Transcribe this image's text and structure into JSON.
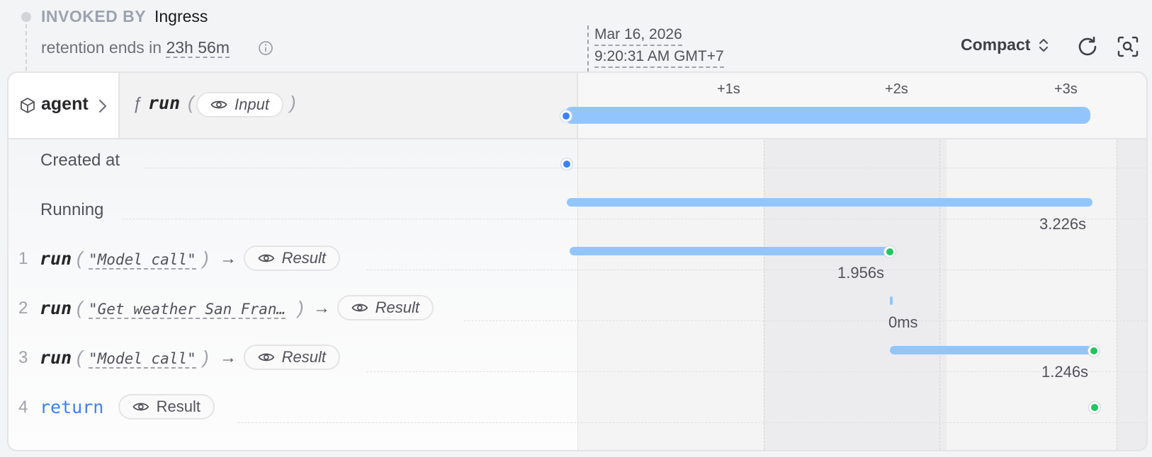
{
  "header": {
    "invoked_by_label": "INVOKED BY",
    "invoked_by_value": "Ingress",
    "retention_prefix": "retention ends in",
    "retention_value": "23h 56m",
    "date": "Mar 16, 2026",
    "time": "9:20:31 AM GMT+7",
    "view_mode": "Compact"
  },
  "target": {
    "service": "agent",
    "fn_symbol": "ƒ",
    "handler": "run",
    "input_label": "Input"
  },
  "timeline": {
    "ticks": [
      "+1s",
      "+2s",
      "+3s"
    ]
  },
  "rows": {
    "created_at": "Created at",
    "running": "Running",
    "running_duration": "3.226s"
  },
  "steps": [
    {
      "num": "1",
      "name": "run",
      "arg": "\"Model call\"",
      "result_label": "Result",
      "duration": "1.956s"
    },
    {
      "num": "2",
      "name": "run",
      "arg": "\"Get weather San Fran…",
      "result_label": "Result",
      "duration": "0ms"
    },
    {
      "num": "3",
      "name": "run",
      "arg": "\"Model call\"",
      "result_label": "Result",
      "duration": "1.246s"
    },
    {
      "num": "4",
      "name": "return",
      "result_label": "Result"
    }
  ],
  "icons": {
    "info": "info-icon",
    "sort": "chevron-up-down-icon",
    "refresh": "refresh-icon",
    "zoom": "zoom-fit-icon",
    "box": "cube-icon",
    "chevron": "chevron-right-icon",
    "eye": "eye-icon",
    "arrow": "arrow-right-icon"
  },
  "colors": {
    "bar": "#93c5fd",
    "start_dot": "#3b82f6",
    "end_dot": "#22c55e",
    "return_keyword": "#3b82f6"
  }
}
